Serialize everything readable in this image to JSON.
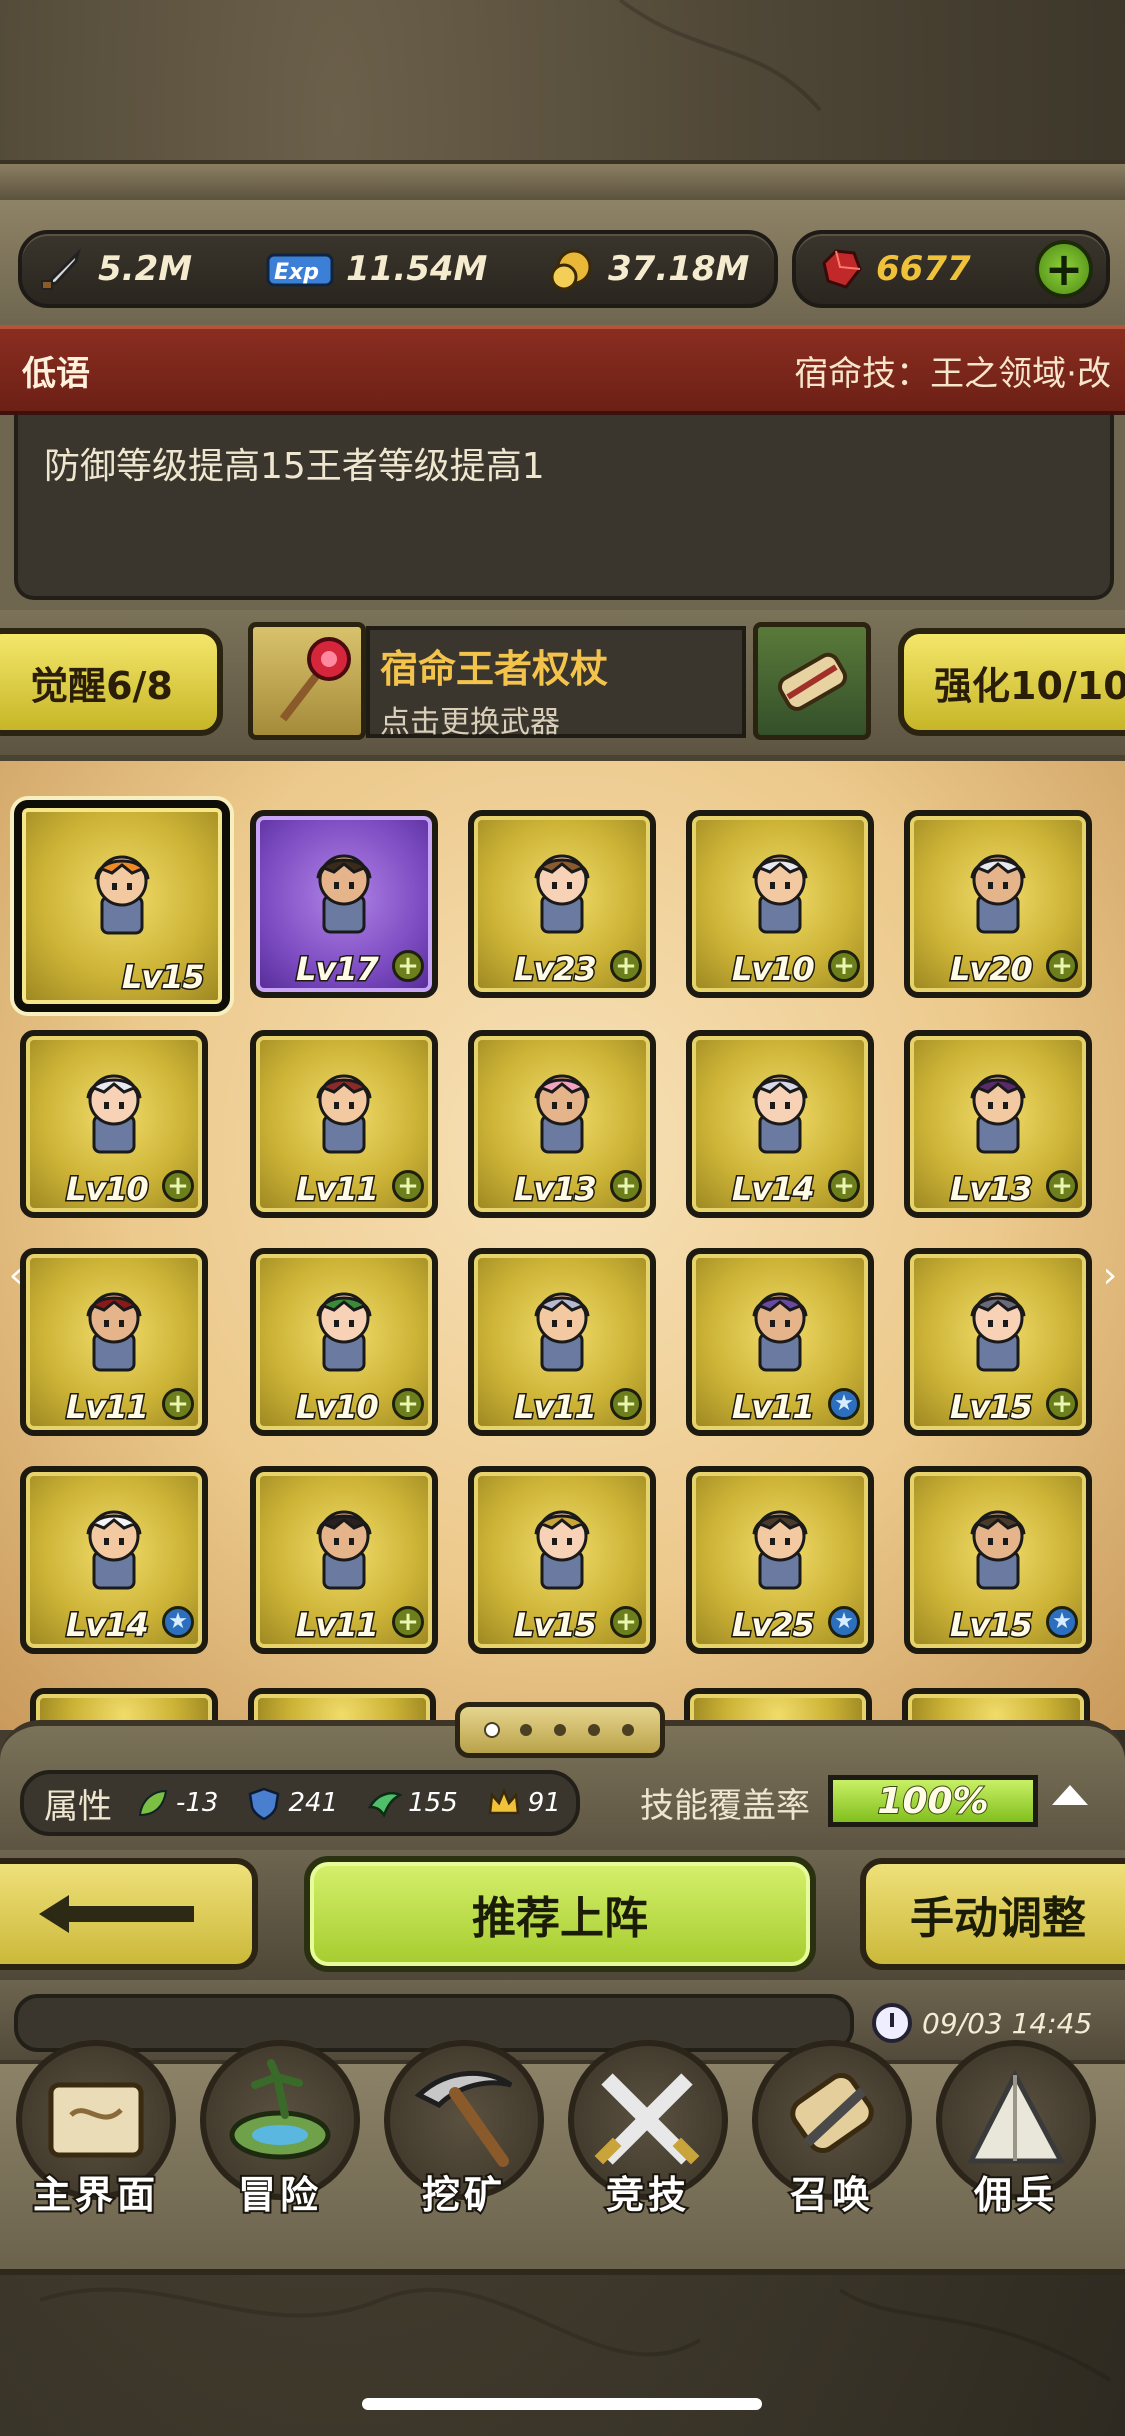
{
  "resources": {
    "attack": "5.2M",
    "exp_icon_text": "Exp",
    "exp": "11.54M",
    "gold": "37.18M",
    "gems": "6677",
    "add_label": "+"
  },
  "title_bar": {
    "hero_name": "低语",
    "fate_skill": "宿命技：王之领域·改"
  },
  "description": "防御等级提高15王者等级提高1",
  "weapon_row": {
    "awaken_label": "觉醒6/8",
    "weapon_name": "宿命王者权杖",
    "weapon_tip": "点击更换武器",
    "enhance_label": "强化10/10"
  },
  "heroes": [
    {
      "level": "Lv15",
      "selected": true,
      "badge": ""
    },
    {
      "level": "Lv17",
      "frame": "purple",
      "badge": "+"
    },
    {
      "level": "Lv23",
      "badge": "+"
    },
    {
      "level": "Lv10",
      "badge": "+"
    },
    {
      "level": "Lv20",
      "badge": "+"
    },
    {
      "level": "Lv10",
      "badge": "+"
    },
    {
      "level": "Lv11",
      "badge": "+"
    },
    {
      "level": "Lv13",
      "badge": "+"
    },
    {
      "level": "Lv14",
      "badge": "+"
    },
    {
      "level": "Lv13",
      "badge": "+"
    },
    {
      "level": "Lv11",
      "badge": "+"
    },
    {
      "level": "Lv10",
      "badge": "+"
    },
    {
      "level": "Lv11",
      "badge": "+"
    },
    {
      "level": "Lv11",
      "badge": "★"
    },
    {
      "level": "Lv15",
      "badge": "+"
    },
    {
      "level": "Lv14",
      "badge": "★"
    },
    {
      "level": "Lv11",
      "badge": "+"
    },
    {
      "level": "Lv15",
      "badge": "+"
    },
    {
      "level": "Lv25",
      "badge": "★"
    },
    {
      "level": "Lv15",
      "badge": "★"
    }
  ],
  "pager": {
    "pages": 5,
    "current": 1
  },
  "stats": {
    "attr_label": "属性",
    "nature": "-13",
    "defense": "241",
    "speed": "155",
    "crown": "91",
    "coverage_label": "技能覆盖率",
    "coverage_value": "100%",
    "coverage_fraction": 1.0
  },
  "actions": {
    "recommend": "推荐上阵",
    "manual": "手动调整"
  },
  "status": {
    "datetime": "09/03 14:45"
  },
  "nav": [
    {
      "label": "主界面",
      "icon": "map-scroll-icon"
    },
    {
      "label": "冒险",
      "icon": "island-icon"
    },
    {
      "label": "挖矿",
      "icon": "pickaxe-icon"
    },
    {
      "label": "竞技",
      "icon": "crossed-swords-icon"
    },
    {
      "label": "召唤",
      "icon": "summon-scroll-icon"
    },
    {
      "label": "佣兵",
      "icon": "tent-icon"
    }
  ],
  "colors": {
    "gold_frame": "#cdb437",
    "purple_frame": "#7d4cc2",
    "title_bar": "#8a2d20",
    "accent_green": "#a5cc2e",
    "gem_text": "#f0c23a"
  }
}
